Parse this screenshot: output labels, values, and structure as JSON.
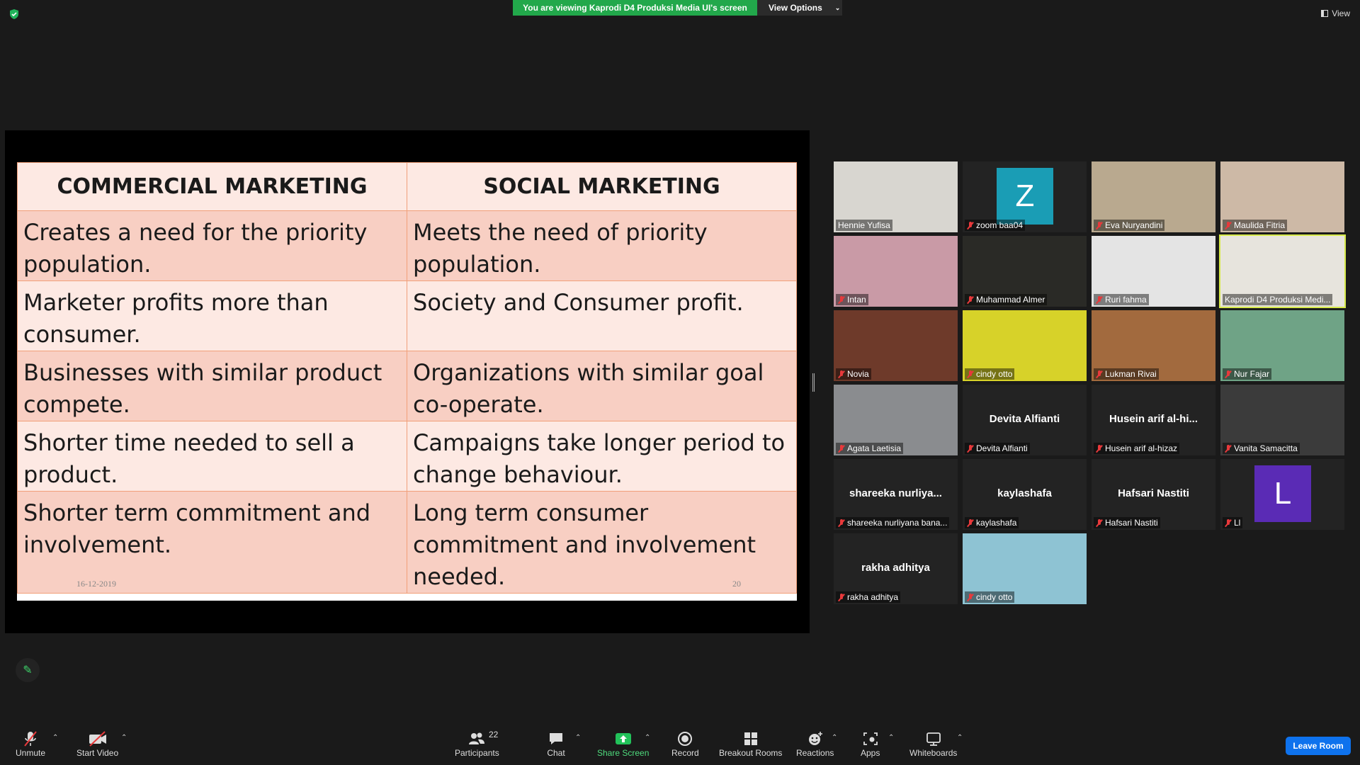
{
  "banner": {
    "text": "You are viewing Kaprodi D4 Produksi Media UI's screen",
    "view_options": "View Options",
    "view": "View"
  },
  "slide": {
    "headers": [
      "COMMERCIAL MARKETING",
      "SOCIAL MARKETING"
    ],
    "rows": [
      [
        "Creates a need for the priority population.",
        "Meets the need of priority population."
      ],
      [
        "Marketer profits more than consumer.",
        "Society and Consumer profit."
      ],
      [
        "Businesses with similar product compete.",
        "Organizations with similar goal co-operate."
      ],
      [
        "Shorter time needed to sell a product.",
        "Campaigns take longer period to change behaviour."
      ],
      [
        "Shorter term commitment and involvement.",
        "Long term consumer commitment and  involvement needed."
      ]
    ],
    "footer_date": "16-12-2019",
    "footer_page": "20"
  },
  "participants": [
    {
      "name": "Hennie Yufisa",
      "muted": false,
      "bg": "#d8d6d0"
    },
    {
      "name": "zoom baa04",
      "muted": true,
      "avatar": "Z",
      "avatar_color": "#1a9db5"
    },
    {
      "name": "Eva Nuryandini",
      "muted": true,
      "bg": "#b9a98f"
    },
    {
      "name": "Maulida Fitria",
      "muted": true,
      "bg": "#cdb9a6"
    },
    {
      "name": "Intan",
      "muted": true,
      "bg": "#c99aa6"
    },
    {
      "name": "Muhammad Almer",
      "muted": true,
      "bg": "#2a2a26"
    },
    {
      "name": "Ruri fahma",
      "muted": true,
      "bg": "#e4e4e4"
    },
    {
      "name": "Kaprodi D4 Produksi Medi...",
      "muted": false,
      "bg": "#e7e4dd",
      "active": true
    },
    {
      "name": "Novia",
      "muted": true,
      "bg": "#6e3a2a"
    },
    {
      "name": "cindy otto",
      "muted": true,
      "bg": "#d7d229"
    },
    {
      "name": "Lukman Rivai",
      "muted": true,
      "bg": "#a26a3e"
    },
    {
      "name": "Nur Fajar",
      "muted": true,
      "bg": "#6fa386"
    },
    {
      "name": "Agata Laetisia",
      "muted": true,
      "bg": "#8a8c8f"
    },
    {
      "name": "Devita Alfianti",
      "muted": true,
      "display": "Devita Alfianti"
    },
    {
      "name": "Husein arif al-hizaz",
      "muted": true,
      "display": "Husein  arif  al-hi..."
    },
    {
      "name": "Vanita Samacitta",
      "muted": true,
      "bg": "#3b3b3b"
    },
    {
      "name": "shareeka nurliyana bana...",
      "muted": true,
      "display": "shareeka  nurliya..."
    },
    {
      "name": "kaylashafa",
      "muted": true,
      "display": "kaylashafa"
    },
    {
      "name": "Hafsari Nastiti",
      "muted": true,
      "display": "Hafsari Nastiti"
    },
    {
      "name": "Ll",
      "muted": true,
      "avatar": "L",
      "avatar_color": "#5a2bb5"
    },
    {
      "name": "rakha adhitya",
      "muted": true,
      "display": "rakha adhitya"
    },
    {
      "name": "cindy otto",
      "muted": true,
      "bg": "#8ec3d3"
    }
  ],
  "toolbar": {
    "unmute": "Unmute",
    "start_video": "Start Video",
    "participants": "Participants",
    "participants_count": "22",
    "chat": "Chat",
    "share_screen": "Share Screen",
    "record": "Record",
    "breakout_rooms": "Breakout Rooms",
    "reactions": "Reactions",
    "apps": "Apps",
    "whiteboards": "Whiteboards",
    "leave": "Leave Room"
  },
  "colors": {
    "share_green": "#22a84b",
    "leave_blue": "#0e72ed",
    "active_speaker": "#d6e94a",
    "mute_red": "#e8393b"
  }
}
